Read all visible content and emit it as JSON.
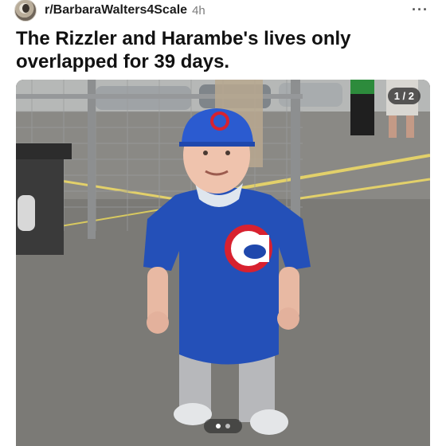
{
  "post": {
    "subreddit": "r/BarbaraWalters4Scale",
    "age": "4h",
    "more": "···",
    "title": "The Rizzler and Harambe's lives only overlapped for 39 days."
  },
  "gallery": {
    "counter": "1 / 2",
    "current": 1,
    "total": 2
  },
  "icons": {
    "avatar": "subreddit-avatar-icon",
    "more": "more-options-icon"
  },
  "colors": {
    "jersey": "#2450b8",
    "cap": "#2b5bd0",
    "logo_red": "#d8212f"
  }
}
